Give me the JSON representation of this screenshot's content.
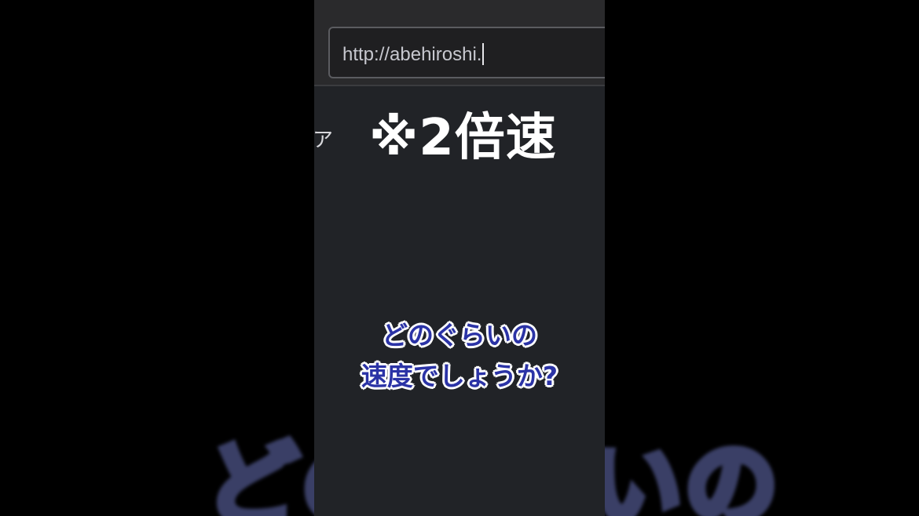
{
  "video": {
    "url_text": "http://abehiroshi.",
    "side_glyph": "ア",
    "speed_note": "※2倍速",
    "question_line1": "どのぐらいの",
    "question_line2": "速度でしょうか?"
  },
  "background": {
    "caption_text": "どのぐらいの"
  },
  "colors": {
    "page_bg": "#000000",
    "video_bg": "#212327",
    "caption_fill": "#2b33a6",
    "caption_outline": "#ffffff"
  }
}
